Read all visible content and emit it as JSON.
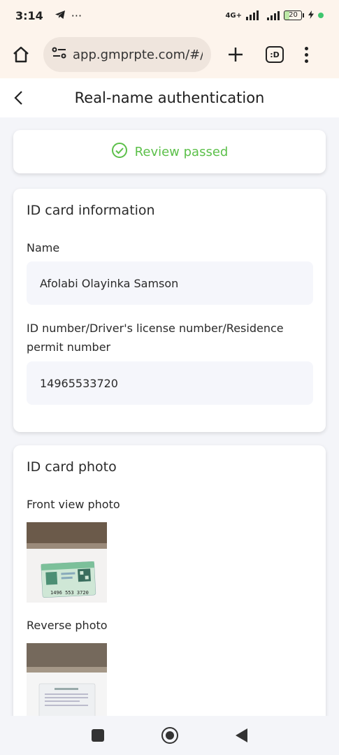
{
  "status_bar": {
    "time": "3:14",
    "overflow": "···",
    "network": "4G+",
    "battery": "20",
    "icons": [
      "telegram-icon",
      "signal-icon",
      "battery-icon",
      "charging-icon"
    ]
  },
  "browser": {
    "url": "app.gmprpte.com/#/pag",
    "tabs_count": ":D",
    "icons": [
      "home-icon",
      "site-settings-icon",
      "new-tab-icon",
      "tabs-icon",
      "more-icon"
    ]
  },
  "header": {
    "title": "Real-name authentication",
    "back_icon": "chevron-left-icon"
  },
  "review": {
    "status": "Review passed",
    "icon": "check-circle-icon",
    "color": "#5cc04a"
  },
  "id_info": {
    "title": "ID card information",
    "name_label": "Name",
    "name_value": "Afolabi Olayinka Samson",
    "id_label": "ID number/Driver's license number/Residence permit number",
    "id_value": "14965533720"
  },
  "id_photo": {
    "title": "ID card photo",
    "front_label": "Front view photo",
    "front_card_digits": "1496 553 3720",
    "reverse_label": "Reverse photo"
  },
  "nav": {
    "icons": [
      "recents-icon",
      "home-icon",
      "back-icon"
    ]
  }
}
